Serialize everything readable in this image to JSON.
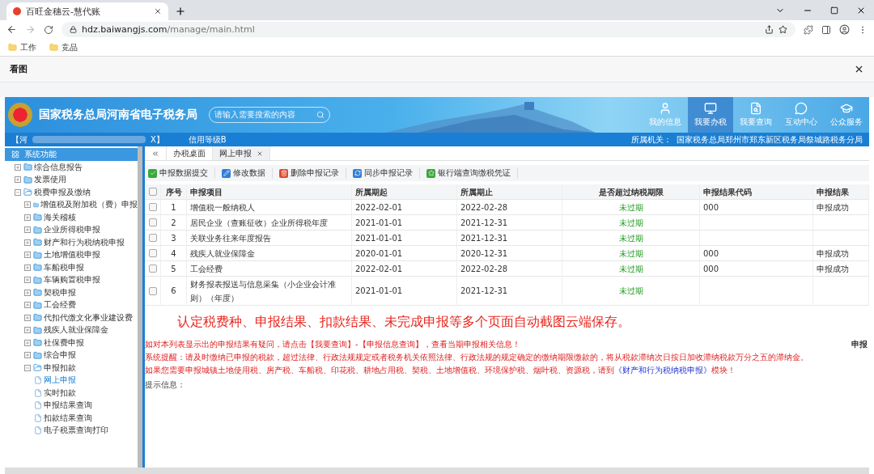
{
  "browser": {
    "tab_title": "百旺金穗云-慧代账",
    "url_host": "hdz.baiwangjs.com",
    "url_path": "/manage/main.html",
    "bookmarks": [
      "工作",
      "竞品"
    ]
  },
  "viewer": {
    "title": "看图"
  },
  "banner": {
    "title": "国家税务总局河南省电子税务局",
    "search_placeholder": "请输入需要搜索的内容",
    "nav": [
      {
        "label": "我的信息",
        "selected": false
      },
      {
        "label": "我要办税",
        "selected": true
      },
      {
        "label": "我要查询",
        "selected": false
      },
      {
        "label": "互动中心",
        "selected": false
      },
      {
        "label": "公众服务",
        "selected": false
      }
    ]
  },
  "info_bar": {
    "taxpayer_prefix": "【河",
    "taxpayer_suffix": "X】",
    "credit": "信用等级B",
    "authority_label": "所属机关：",
    "authority": "国家税务总局郑州市郑东新区税务局祭城路税务分局"
  },
  "sidebar": {
    "title": "系统功能",
    "items": [
      {
        "label": "综合信息报告",
        "expanded": false
      },
      {
        "label": "发票使用",
        "expanded": false
      },
      {
        "label": "税费申报及缴纳",
        "expanded": true,
        "children": [
          {
            "label": "增值税及附加税（费）申报",
            "expanded": false
          },
          {
            "label": "海关稽核",
            "expanded": false
          },
          {
            "label": "企业所得税申报",
            "expanded": false
          },
          {
            "label": "财产和行为税纳税申报",
            "expanded": false
          },
          {
            "label": "土地增值税申报",
            "expanded": false
          },
          {
            "label": "车船税申报",
            "expanded": false
          },
          {
            "label": "车辆购置税申报",
            "expanded": false
          },
          {
            "label": "契税申报",
            "expanded": false
          },
          {
            "label": "工会经费",
            "expanded": false
          },
          {
            "label": "代扣代缴文化事业建设费",
            "expanded": false
          },
          {
            "label": "残疾人就业保障金",
            "expanded": false
          },
          {
            "label": "社保费申报",
            "expanded": false
          },
          {
            "label": "综合申报",
            "expanded": false
          },
          {
            "label": "申报扣款",
            "expanded": true,
            "children": [
              {
                "label": "网上申报",
                "selected": true
              },
              {
                "label": "实时扣款",
                "selected": false
              },
              {
                "label": "申报结果查询",
                "selected": false
              },
              {
                "label": "扣款结果查询",
                "selected": false
              },
              {
                "label": "电子税票查询打印",
                "selected": false
              }
            ]
          }
        ]
      }
    ]
  },
  "tabs": [
    {
      "label": "办税桌面",
      "selected": false,
      "closable": false
    },
    {
      "label": "网上申报",
      "selected": true,
      "closable": true
    }
  ],
  "toolbar": [
    {
      "label": "申报数据提交"
    },
    {
      "label": "修改数据"
    },
    {
      "label": "删除申报记录"
    },
    {
      "label": "同步申报记录"
    },
    {
      "label": "银行端查询缴税凭证"
    }
  ],
  "table": {
    "all_checked": false,
    "columns": [
      "序号",
      "申报项目",
      "所属期起",
      "所属期止",
      "是否超过纳税期限",
      "申报结果代码",
      "申报结果"
    ],
    "rows": [
      {
        "checked": false,
        "cells": [
          "1",
          "增值税一般纳税人",
          "2022-02-01",
          "2022-02-28",
          "未过期",
          "000",
          "申报成功"
        ]
      },
      {
        "checked": false,
        "cells": [
          "2",
          "居民企业（查账征收）企业所得税年度",
          "2021-01-01",
          "2021-12-31",
          "未过期",
          "",
          ""
        ]
      },
      {
        "checked": false,
        "cells": [
          "3",
          "关联业务往来年度报告",
          "2021-01-01",
          "2021-12-31",
          "未过期",
          "",
          ""
        ]
      },
      {
        "checked": false,
        "cells": [
          "4",
          "残疾人就业保障金",
          "2020-01-01",
          "2020-12-31",
          "未过期",
          "000",
          "申报成功"
        ]
      },
      {
        "checked": false,
        "cells": [
          "5",
          "工会经费",
          "2022-02-01",
          "2022-02-28",
          "未过期",
          "000",
          "申报成功"
        ]
      },
      {
        "checked": false,
        "cells": [
          "6",
          "财务报表报送与信息采集（小企业会计准则）（年度）",
          "2021-01-01",
          "2021-12-31",
          "未过期",
          "",
          ""
        ]
      }
    ]
  },
  "overlay_caption": "认定税费种、申报结果、扣款结果、未完成申报等多个页面自动截图云端保存。",
  "notices": [
    {
      "text": "如对本列表显示出的申报结果有疑问，请点击【我要查询】-【申报信息查询】，查看当期申报相关信息！"
    },
    {
      "text": "系统提醒：请及时缴纳已申报的税款，超过法律、行政法规规定或者税务机关依照法律、行政法规的规定确定的缴纳期限缴款的，将从税款滞纳次日按日加收滞纳税款万分之五的滞纳金。"
    },
    {
      "text": "如果您需要申报城镇土地使用税、房产税、车船税、印花税、耕地占用税、契税、土地增值税、环境保护税、烟叶税、资源税，请到",
      "link": "《财产和行为税纳税申报》",
      "after": "模块！"
    }
  ],
  "right_edge_label": "申报",
  "hint_label": "提示信息："
}
